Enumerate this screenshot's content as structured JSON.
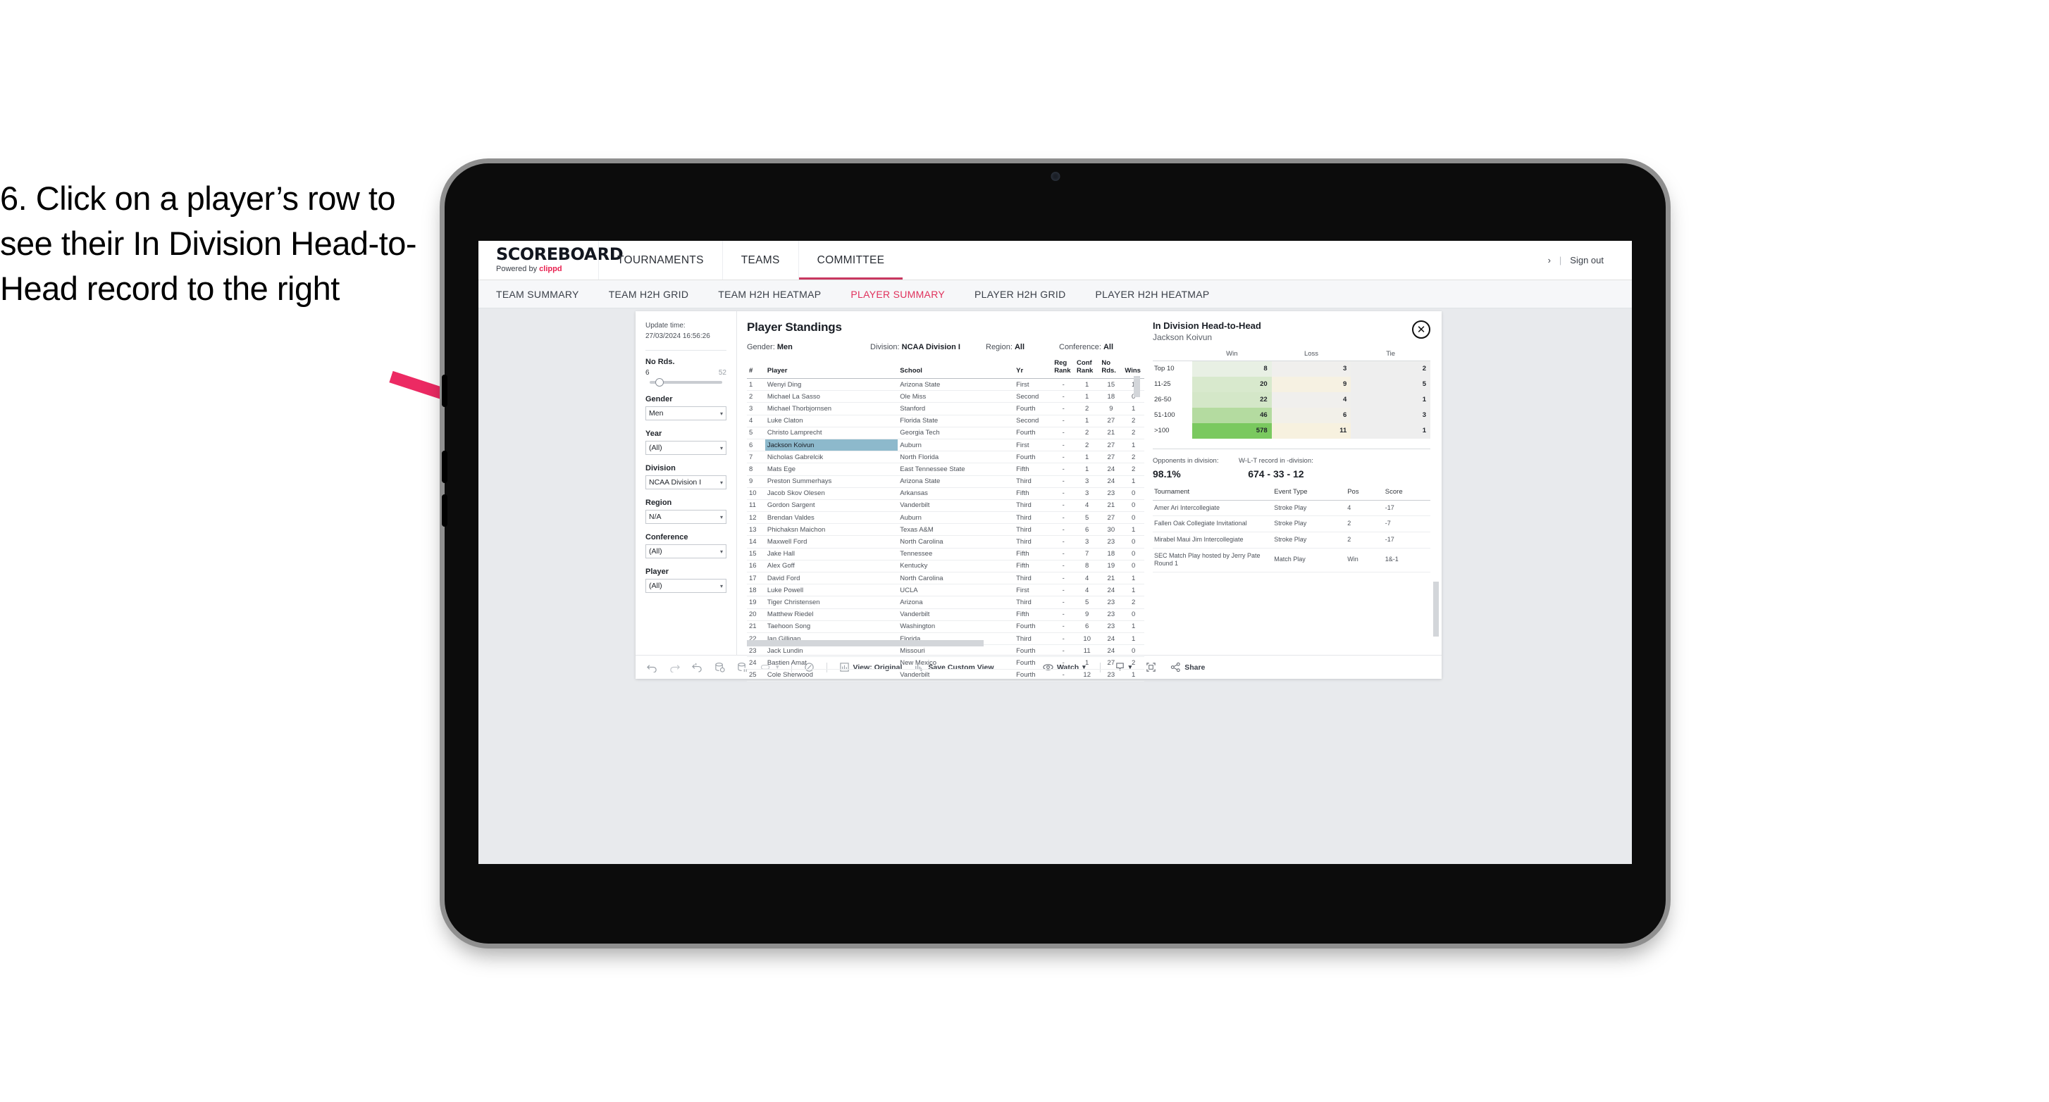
{
  "annotation": {
    "text": "6. Click on a player’s row to see their In Division Head-to-Head record to the right",
    "arrow_color": "#ec2a63"
  },
  "header": {
    "brand_title": "SCOREBOARD",
    "brand_sub_prefix": "Powered by ",
    "brand_sub_name": "clippd",
    "tabs": [
      {
        "label": "TOURNAMENTS",
        "active": false
      },
      {
        "label": "TEAMS",
        "active": false
      },
      {
        "label": "COMMITTEE",
        "active": true
      }
    ],
    "user_caret": "›",
    "separator": "|",
    "sign_out": "Sign out"
  },
  "subnav": {
    "tabs": [
      {
        "label": "TEAM SUMMARY",
        "active": false
      },
      {
        "label": "TEAM H2H GRID",
        "active": false
      },
      {
        "label": "TEAM H2H HEATMAP",
        "active": false
      },
      {
        "label": "PLAYER SUMMARY",
        "active": true
      },
      {
        "label": "PLAYER H2H GRID",
        "active": false
      },
      {
        "label": "PLAYER H2H HEATMAP",
        "active": false
      }
    ],
    "accent": "#e0315c"
  },
  "filters": {
    "update_label": "Update time:",
    "update_value": "27/03/2024 16:56:26",
    "slider": {
      "title": "No Rds.",
      "min": "6",
      "max": "52",
      "value_pct": 8
    },
    "groups": [
      {
        "title": "Gender",
        "value": "Men"
      },
      {
        "title": "Year",
        "value": "(All)"
      },
      {
        "title": "Division",
        "value": "NCAA Division I"
      },
      {
        "title": "Region",
        "value": "N/A"
      },
      {
        "title": "Conference",
        "value": "(All)"
      },
      {
        "title": "Player",
        "value": "(All)"
      }
    ],
    "caret": "▾"
  },
  "standings": {
    "title": "Player Standings",
    "meta": [
      {
        "label": "Gender: ",
        "value": "Men"
      },
      {
        "label": "Division: ",
        "value": "NCAA Division I"
      },
      {
        "label": "Region: ",
        "value": "All"
      },
      {
        "label": "Conference: ",
        "value": "All"
      }
    ],
    "columns": [
      "#",
      "Player",
      "School",
      "Yr",
      "Reg Rank",
      "Conf Rank",
      "No Rds.",
      "Wins"
    ],
    "rows": [
      {
        "rank": "1",
        "player": "Wenyi Ding",
        "school": "Arizona State",
        "yr": "First",
        "reg": "-",
        "conf": "1",
        "rds": "15",
        "wins": "1",
        "selected": false
      },
      {
        "rank": "2",
        "player": "Michael La Sasso",
        "school": "Ole Miss",
        "yr": "Second",
        "reg": "-",
        "conf": "1",
        "rds": "18",
        "wins": "0",
        "selected": false
      },
      {
        "rank": "3",
        "player": "Michael Thorbjornsen",
        "school": "Stanford",
        "yr": "Fourth",
        "reg": "-",
        "conf": "2",
        "rds": "9",
        "wins": "1",
        "selected": false
      },
      {
        "rank": "4",
        "player": "Luke Claton",
        "school": "Florida State",
        "yr": "Second",
        "reg": "-",
        "conf": "1",
        "rds": "27",
        "wins": "2",
        "selected": false
      },
      {
        "rank": "5",
        "player": "Christo Lamprecht",
        "school": "Georgia Tech",
        "yr": "Fourth",
        "reg": "-",
        "conf": "2",
        "rds": "21",
        "wins": "2",
        "selected": false
      },
      {
        "rank": "6",
        "player": "Jackson Koivun",
        "school": "Auburn",
        "yr": "First",
        "reg": "-",
        "conf": "2",
        "rds": "27",
        "wins": "1",
        "selected": true
      },
      {
        "rank": "7",
        "player": "Nicholas Gabrelcik",
        "school": "North Florida",
        "yr": "Fourth",
        "reg": "-",
        "conf": "1",
        "rds": "27",
        "wins": "2",
        "selected": false
      },
      {
        "rank": "8",
        "player": "Mats Ege",
        "school": "East Tennessee State",
        "yr": "Fifth",
        "reg": "-",
        "conf": "1",
        "rds": "24",
        "wins": "2",
        "selected": false
      },
      {
        "rank": "9",
        "player": "Preston Summerhays",
        "school": "Arizona State",
        "yr": "Third",
        "reg": "-",
        "conf": "3",
        "rds": "24",
        "wins": "1",
        "selected": false
      },
      {
        "rank": "10",
        "player": "Jacob Skov Olesen",
        "school": "Arkansas",
        "yr": "Fifth",
        "reg": "-",
        "conf": "3",
        "rds": "23",
        "wins": "0",
        "selected": false
      },
      {
        "rank": "11",
        "player": "Gordon Sargent",
        "school": "Vanderbilt",
        "yr": "Third",
        "reg": "-",
        "conf": "4",
        "rds": "21",
        "wins": "0",
        "selected": false
      },
      {
        "rank": "12",
        "player": "Brendan Valdes",
        "school": "Auburn",
        "yr": "Third",
        "reg": "-",
        "conf": "5",
        "rds": "27",
        "wins": "0",
        "selected": false
      },
      {
        "rank": "13",
        "player": "Phichaksn Maichon",
        "school": "Texas A&M",
        "yr": "Third",
        "reg": "-",
        "conf": "6",
        "rds": "30",
        "wins": "1",
        "selected": false
      },
      {
        "rank": "14",
        "player": "Maxwell Ford",
        "school": "North Carolina",
        "yr": "Third",
        "reg": "-",
        "conf": "3",
        "rds": "23",
        "wins": "0",
        "selected": false
      },
      {
        "rank": "15",
        "player": "Jake Hall",
        "school": "Tennessee",
        "yr": "Fifth",
        "reg": "-",
        "conf": "7",
        "rds": "18",
        "wins": "0",
        "selected": false
      },
      {
        "rank": "16",
        "player": "Alex Goff",
        "school": "Kentucky",
        "yr": "Fifth",
        "reg": "-",
        "conf": "8",
        "rds": "19",
        "wins": "0",
        "selected": false
      },
      {
        "rank": "17",
        "player": "David Ford",
        "school": "North Carolina",
        "yr": "Third",
        "reg": "-",
        "conf": "4",
        "rds": "21",
        "wins": "1",
        "selected": false
      },
      {
        "rank": "18",
        "player": "Luke Powell",
        "school": "UCLA",
        "yr": "First",
        "reg": "-",
        "conf": "4",
        "rds": "24",
        "wins": "1",
        "selected": false
      },
      {
        "rank": "19",
        "player": "Tiger Christensen",
        "school": "Arizona",
        "yr": "Third",
        "reg": "-",
        "conf": "5",
        "rds": "23",
        "wins": "2",
        "selected": false
      },
      {
        "rank": "20",
        "player": "Matthew Riedel",
        "school": "Vanderbilt",
        "yr": "Fifth",
        "reg": "-",
        "conf": "9",
        "rds": "23",
        "wins": "0",
        "selected": false
      },
      {
        "rank": "21",
        "player": "Taehoon Song",
        "school": "Washington",
        "yr": "Fourth",
        "reg": "-",
        "conf": "6",
        "rds": "23",
        "wins": "1",
        "selected": false
      },
      {
        "rank": "22",
        "player": "Ian Gilligan",
        "school": "Florida",
        "yr": "Third",
        "reg": "-",
        "conf": "10",
        "rds": "24",
        "wins": "1",
        "selected": false
      },
      {
        "rank": "23",
        "player": "Jack Lundin",
        "school": "Missouri",
        "yr": "Fourth",
        "reg": "-",
        "conf": "11",
        "rds": "24",
        "wins": "0",
        "selected": false
      },
      {
        "rank": "24",
        "player": "Bastien Amat",
        "school": "New Mexico",
        "yr": "Fourth",
        "reg": "-",
        "conf": "1",
        "rds": "27",
        "wins": "2",
        "selected": false
      },
      {
        "rank": "25",
        "player": "Cole Sherwood",
        "school": "Vanderbilt",
        "yr": "Fourth",
        "reg": "-",
        "conf": "12",
        "rds": "23",
        "wins": "1",
        "selected": false
      }
    ],
    "selected_highlight_color": "#8db9cc"
  },
  "h2h": {
    "title": "In Division Head-to-Head",
    "player": "Jackson Koivun",
    "close_icon": "✕",
    "heatmap_columns": [
      "Win",
      "Loss",
      "Tie"
    ],
    "heatmap_rows": [
      {
        "label": "Top 10",
        "win": "8",
        "loss": "3",
        "tie": "2",
        "win_bg": "#e8f0e4",
        "loss_bg": "#f0efed",
        "tie_bg": "#eeeeee"
      },
      {
        "label": "11-25",
        "win": "20",
        "loss": "9",
        "tie": "5",
        "win_bg": "#d8e9cd",
        "loss_bg": "#f6f1e2",
        "tie_bg": "#eeeeee"
      },
      {
        "label": "26-50",
        "win": "22",
        "loss": "4",
        "tie": "1",
        "win_bg": "#d4e7c8",
        "loss_bg": "#f0efed",
        "tie_bg": "#eeeeee"
      },
      {
        "label": "51-100",
        "win": "46",
        "loss": "6",
        "tie": "3",
        "win_bg": "#b4dba0",
        "loss_bg": "#f2f0e9",
        "tie_bg": "#eeeeee"
      },
      {
        "label": ">100",
        "win": "578",
        "loss": "11",
        "tie": "1",
        "win_bg": "#7ac95f",
        "loss_bg": "#f7f1df",
        "tie_bg": "#eeeeee"
      }
    ],
    "summary": [
      {
        "label": "Opponents in division:",
        "value": "98.1%"
      },
      {
        "label": "W-L-T record in -division:",
        "value": "674 - 33 - 12"
      }
    ],
    "tournament_columns": [
      "Tournament",
      "Event Type",
      "Pos",
      "Score"
    ],
    "tournaments": [
      {
        "name": "Amer Ari Intercollegiate",
        "type": "Stroke Play",
        "pos": "4",
        "score": "-17"
      },
      {
        "name": "Fallen Oak Collegiate Invitational",
        "type": "Stroke Play",
        "pos": "2",
        "score": "-7"
      },
      {
        "name": "Mirabel Maui Jim Intercollegiate",
        "type": "Stroke Play",
        "pos": "2",
        "score": "-17"
      },
      {
        "name": "SEC Match Play hosted by Jerry Pate Round 1",
        "type": "Match Play",
        "pos": "Win",
        "score": "1&-1"
      }
    ]
  },
  "viz_footer": {
    "left_icons": [
      "undo-icon",
      "redo-icon",
      "revert-icon",
      "refresh-icon",
      "pause-icon",
      "highlight-icon",
      "caret-down-icon",
      "divider",
      "zoom-icon",
      "divider"
    ],
    "view_label": "View: Original",
    "save_label": "Save Custom View",
    "watch_label": "Watch",
    "download_label": "",
    "fullscreen_label": "",
    "share_label": "Share",
    "caret": "▾"
  }
}
